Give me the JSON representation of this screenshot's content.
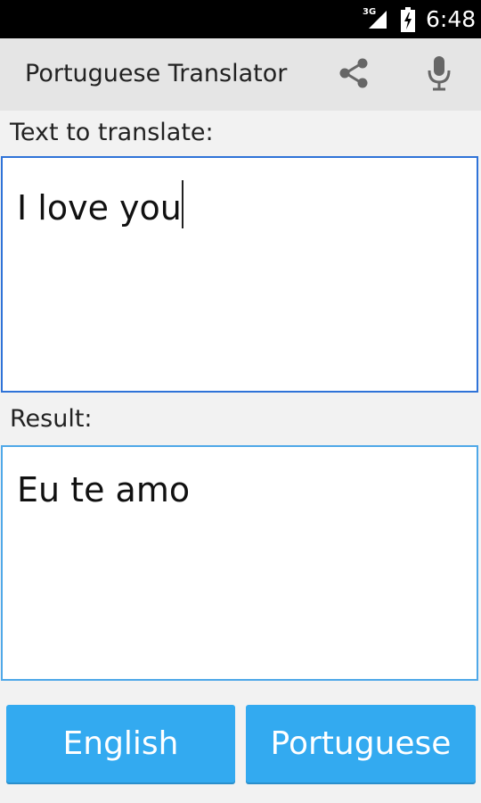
{
  "status_bar": {
    "network": "3G",
    "time": "6:48"
  },
  "action_bar": {
    "title": "Portuguese Translator",
    "share_icon": "share-icon",
    "mic_icon": "microphone-icon"
  },
  "input": {
    "label": "Text to translate:",
    "value": "I love you"
  },
  "result": {
    "label": "Result:",
    "value": "Eu te amo"
  },
  "languages": {
    "source": "English",
    "target": "Portuguese"
  },
  "colors": {
    "button_blue": "#33aaf0",
    "input_border": "#2f73d8",
    "result_border": "#4fa8e8",
    "action_bar": "#e5e5e5"
  }
}
